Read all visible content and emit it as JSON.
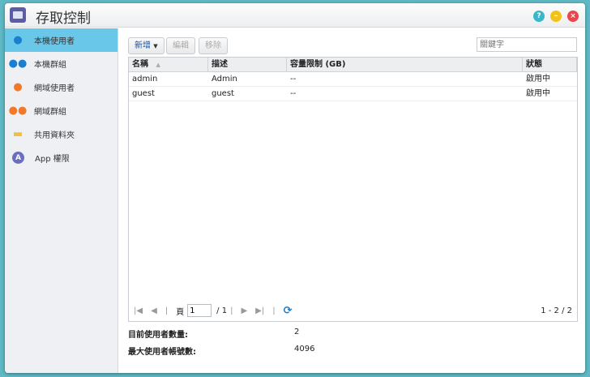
{
  "window": {
    "title": "存取控制"
  },
  "sidebar": {
    "items": [
      {
        "label": "本機使用者",
        "icon": "user-icon",
        "color": "#1a7fd0"
      },
      {
        "label": "本機群組",
        "icon": "group-icon",
        "color": "#1a7fd0"
      },
      {
        "label": "網域使用者",
        "icon": "domain-user-icon",
        "color": "#f07a2a"
      },
      {
        "label": "網域群組",
        "icon": "domain-group-icon",
        "color": "#f07a2a"
      },
      {
        "label": "共用資料夾",
        "icon": "folder-icon",
        "color": "#f0c040"
      },
      {
        "label": "App 權限",
        "icon": "app-icon",
        "color": "#6a6ec0"
      }
    ]
  },
  "toolbar": {
    "add": "新增",
    "edit": "編輯",
    "remove": "移除",
    "search_placeholder": "關鍵字"
  },
  "table": {
    "headers": [
      "名稱",
      "描述",
      "容量限制 (GB)",
      "狀態"
    ],
    "rows": [
      [
        "admin",
        "Admin",
        "--",
        "啟用中"
      ],
      [
        "guest",
        "guest",
        "--",
        "啟用中"
      ]
    ]
  },
  "pager": {
    "page_label": "頁",
    "page": "1",
    "total": "/ 1",
    "range": "1 - 2 / 2"
  },
  "info": {
    "current_label": "目前使用者數量:",
    "current": "2",
    "max_label": "最大使用者帳號數:",
    "max": "4096"
  }
}
